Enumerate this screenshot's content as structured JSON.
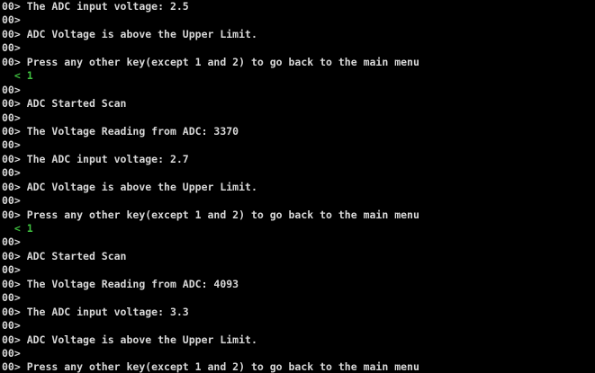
{
  "colors": {
    "background": "#000000",
    "text": "#d8d8d8",
    "sent": "#3fbf3f"
  },
  "lines": [
    {
      "kind": "recv",
      "prefix": "00>",
      "text": " The ADC input voltage: 2.5"
    },
    {
      "kind": "recv",
      "prefix": "00>",
      "text": ""
    },
    {
      "kind": "recv",
      "prefix": "00>",
      "text": " ADC Voltage is above the Upper Limit."
    },
    {
      "kind": "recv",
      "prefix": "00>",
      "text": ""
    },
    {
      "kind": "recv",
      "prefix": "00>",
      "text": " Press any other key(except 1 and 2) to go back to the main menu"
    },
    {
      "kind": "sent",
      "prefix": "  <",
      "text": " 1"
    },
    {
      "kind": "recv",
      "prefix": "00>",
      "text": ""
    },
    {
      "kind": "recv",
      "prefix": "00>",
      "text": " ADC Started Scan"
    },
    {
      "kind": "recv",
      "prefix": "00>",
      "text": ""
    },
    {
      "kind": "recv",
      "prefix": "00>",
      "text": " The Voltage Reading from ADC: 3370"
    },
    {
      "kind": "recv",
      "prefix": "00>",
      "text": ""
    },
    {
      "kind": "recv",
      "prefix": "00>",
      "text": " The ADC input voltage: 2.7"
    },
    {
      "kind": "recv",
      "prefix": "00>",
      "text": ""
    },
    {
      "kind": "recv",
      "prefix": "00>",
      "text": " ADC Voltage is above the Upper Limit."
    },
    {
      "kind": "recv",
      "prefix": "00>",
      "text": ""
    },
    {
      "kind": "recv",
      "prefix": "00>",
      "text": " Press any other key(except 1 and 2) to go back to the main menu"
    },
    {
      "kind": "sent",
      "prefix": "  <",
      "text": " 1"
    },
    {
      "kind": "recv",
      "prefix": "00>",
      "text": ""
    },
    {
      "kind": "recv",
      "prefix": "00>",
      "text": " ADC Started Scan"
    },
    {
      "kind": "recv",
      "prefix": "00>",
      "text": ""
    },
    {
      "kind": "recv",
      "prefix": "00>",
      "text": " The Voltage Reading from ADC: 4093"
    },
    {
      "kind": "recv",
      "prefix": "00>",
      "text": ""
    },
    {
      "kind": "recv",
      "prefix": "00>",
      "text": " The ADC input voltage: 3.3"
    },
    {
      "kind": "recv",
      "prefix": "00>",
      "text": ""
    },
    {
      "kind": "recv",
      "prefix": "00>",
      "text": " ADC Voltage is above the Upper Limit."
    },
    {
      "kind": "recv",
      "prefix": "00>",
      "text": ""
    },
    {
      "kind": "recv",
      "prefix": "00>",
      "text": " Press any other key(except 1 and 2) to go back to the main menu"
    }
  ]
}
